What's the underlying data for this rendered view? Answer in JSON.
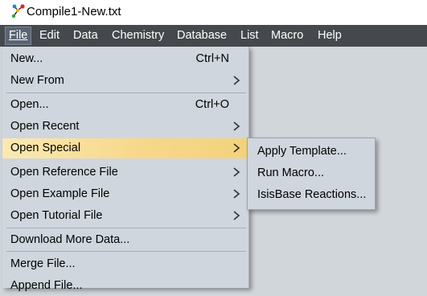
{
  "window": {
    "title": "Compile1-New.txt"
  },
  "menubar": {
    "items": [
      {
        "label": "File"
      },
      {
        "label": "Edit"
      },
      {
        "label": "Data"
      },
      {
        "label": "Chemistry"
      },
      {
        "label": "Database"
      },
      {
        "label": "List"
      },
      {
        "label": "Macro"
      },
      {
        "label": "Help"
      }
    ]
  },
  "file_menu": {
    "items": [
      {
        "label": "New...",
        "shortcut": "Ctrl+N"
      },
      {
        "label": "New From"
      },
      {
        "label": "Open...",
        "shortcut": "Ctrl+O"
      },
      {
        "label": "Open Recent"
      },
      {
        "label": "Open Special"
      },
      {
        "label": "Open Reference File"
      },
      {
        "label": "Open Example File"
      },
      {
        "label": "Open Tutorial File"
      },
      {
        "label": "Download More Data..."
      },
      {
        "label": "Merge File..."
      },
      {
        "label": "Append File..."
      }
    ]
  },
  "open_special_submenu": {
    "items": [
      {
        "label": "Apply Template..."
      },
      {
        "label": "Run Macro..."
      },
      {
        "label": "IsisBase Reactions..."
      }
    ]
  },
  "colors": {
    "menubar_bg": "#45494d",
    "menu_bg": "#cfd6dd",
    "highlight": "#f7d88b",
    "desktop": "#d1d6db"
  },
  "icons": {
    "app": "molecule-icon",
    "submenu_arrow": "chevron-right-icon"
  }
}
